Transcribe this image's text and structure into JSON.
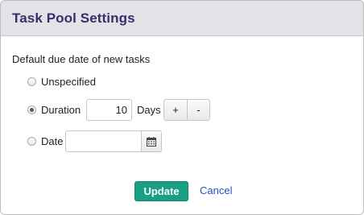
{
  "dialog": {
    "title": "Task Pool Settings",
    "section_label": "Default due date of new tasks"
  },
  "options": {
    "unspecified": {
      "label": "Unspecified",
      "checked": false
    },
    "duration": {
      "label": "Duration",
      "checked": true,
      "value": "10",
      "unit": "Days"
    },
    "date": {
      "label": "Date",
      "checked": false,
      "value": ""
    }
  },
  "stepper": {
    "plus": "+",
    "minus": "-"
  },
  "icons": {
    "calendar": "calendar-icon"
  },
  "buttons": {
    "update": "Update",
    "cancel": "Cancel"
  },
  "colors": {
    "title": "#3b2c6b",
    "update_bg": "#1a9e84",
    "link": "#1f4fcf"
  }
}
